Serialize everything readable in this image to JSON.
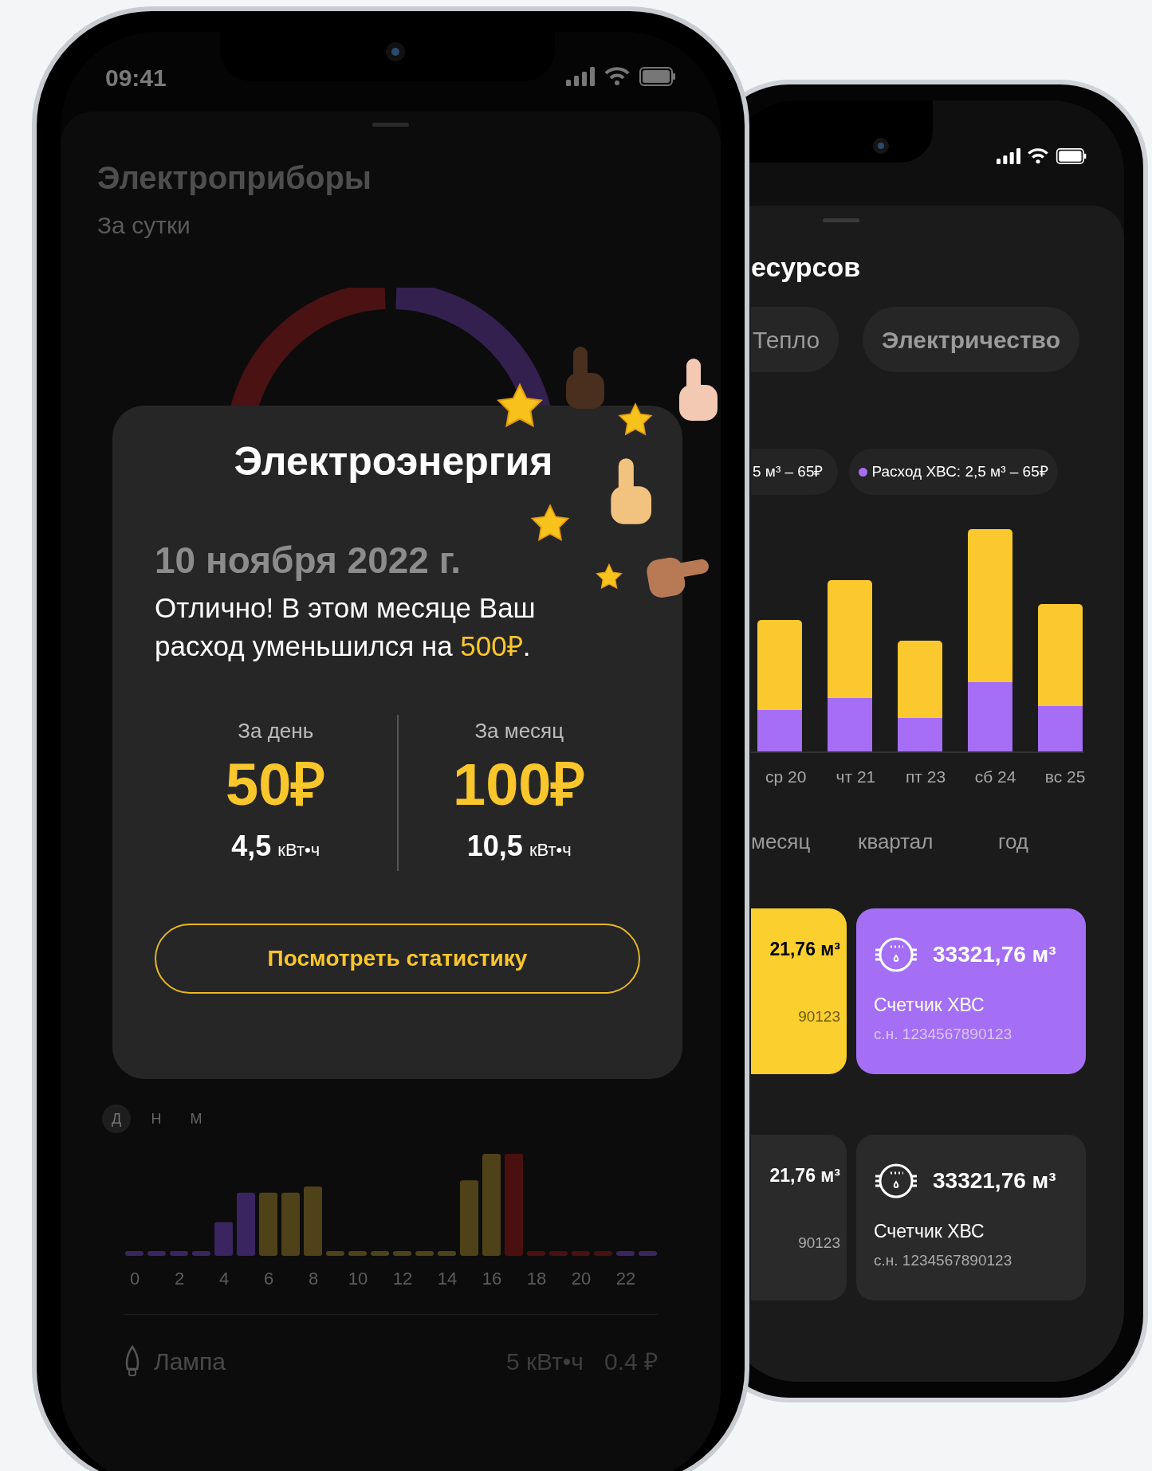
{
  "left_phone": {
    "status_bar": {
      "time": "09:41"
    },
    "sheet": {
      "title": "Электроприборы",
      "subtitle": "За сутки",
      "period_toggle": [
        {
          "label": "Д",
          "selected": true
        },
        {
          "label": "Н",
          "selected": false
        },
        {
          "label": "М",
          "selected": false
        }
      ],
      "hour_labels": [
        "0",
        "2",
        "4",
        "6",
        "8",
        "10",
        "12",
        "14",
        "16",
        "18",
        "20",
        "22"
      ],
      "device": {
        "name": "Лампа",
        "energy": "5 кВт•ч",
        "cost": "0.4 ₽"
      }
    },
    "popup": {
      "title": "Электроэнергия",
      "date": "10 ноября 2022 г.",
      "message": [
        {
          "kind": "plain",
          "text": "Отлично! В этом месяце Ваш расход уменьшился на "
        },
        {
          "kind": "accent",
          "text": "500₽"
        },
        {
          "kind": "plain",
          "text": "."
        }
      ],
      "stats": [
        {
          "label": "За день",
          "amount": "50₽",
          "value": "4,5",
          "unit": "кВт•ч"
        },
        {
          "label": "За месяц",
          "amount": "100₽",
          "value": "10,5",
          "unit": "кВт•ч"
        }
      ],
      "button": "Посмотреть статистику"
    }
  },
  "right_phone": {
    "heading": "есурсов",
    "resource_tabs": [
      "Тепло",
      "Электричество"
    ],
    "legend": [
      {
        "text": "5 м³ – 65₽"
      },
      {
        "text": "Расход ХВС: 2,5 м³ – 65₽",
        "color": "#a66ef5"
      }
    ],
    "day_labels": [
      "ср 20",
      "чт 21",
      "пт 23",
      "сб 24",
      "вс 25"
    ],
    "periods": [
      "месяц",
      "квартал",
      "год"
    ],
    "meters": [
      {
        "kind": "yellow",
        "reading": "21,76 м³",
        "serial": "90123"
      },
      {
        "kind": "purple",
        "reading": "33321,76 м³",
        "name": "Счетчик ХВС",
        "serial": "с.н. 1234567890123"
      },
      {
        "kind": "dark",
        "reading": "21,76 м³",
        "serial": "90123"
      },
      {
        "kind": "dark",
        "reading": "33321,76 м³",
        "name": "Счетчик ХВС",
        "serial": "с.н. 1234567890123"
      }
    ]
  }
}
